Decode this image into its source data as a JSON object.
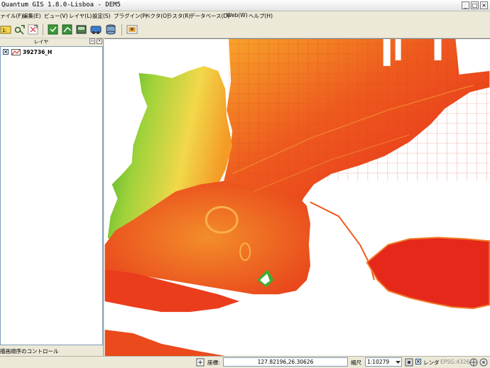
{
  "window": {
    "title": "Quantum GIS 1.8.0-Lisboa - DEM5",
    "minimize": "_",
    "maximize": "□",
    "close": "×"
  },
  "menu": {
    "items": [
      "ァイル(F)",
      "編集(E)",
      "ビュー(V)",
      "レイヤ(L)",
      "設定(S)",
      "プラグイン(P)",
      "ベクタ(O)",
      "ラスタ(R)",
      "データベース(D)",
      "Web(W)",
      "ヘルプ(H)"
    ]
  },
  "legend": {
    "title": "レイヤ",
    "layer_name": "392736_H",
    "layer_checked": "×",
    "render_order_label": "描画順序のコントロール"
  },
  "status": {
    "coord_label": "座標:",
    "coord_value": "127.82196,26.30626",
    "scale_label": "縮尺",
    "scale_value": "1:10279",
    "render_label": "レンダ",
    "render_checked": "×",
    "crs": "EPSG:4326"
  },
  "colors": {
    "map_high": "#e8281a",
    "map_mid": "#f07d20",
    "map_low": "#3cb834",
    "accent": "#316ac5"
  }
}
